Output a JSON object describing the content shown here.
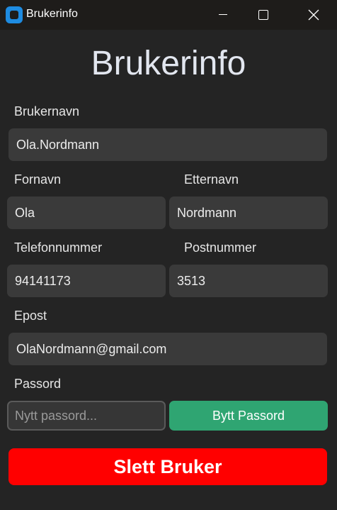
{
  "window": {
    "title": "Brukerinfo",
    "icon": "app-icon",
    "controls": [
      "minimize-icon",
      "maximize-icon",
      "close-icon"
    ]
  },
  "heading": "Brukerinfo",
  "fields": {
    "username": {
      "label": "Brukernavn",
      "value": "Ola.Nordmann"
    },
    "first_name": {
      "label": "Fornavn",
      "value": "Ola"
    },
    "last_name": {
      "label": "Etternavn",
      "value": "Nordmann"
    },
    "phone": {
      "label": "Telefonnummer",
      "value": "94141173"
    },
    "postcode": {
      "label": "Postnummer",
      "value": "3513"
    },
    "email": {
      "label": "Epost",
      "value": "OlaNordmann@gmail.com"
    },
    "password": {
      "label": "Passord",
      "placeholder": "Nytt passord..."
    }
  },
  "buttons": {
    "change_password": "Bytt Passord",
    "delete_user": "Slett Bruker"
  },
  "colors": {
    "background": "#242424",
    "field": "#3a3a3a",
    "accent_green": "#2fa572",
    "danger_red": "#ff0000"
  }
}
